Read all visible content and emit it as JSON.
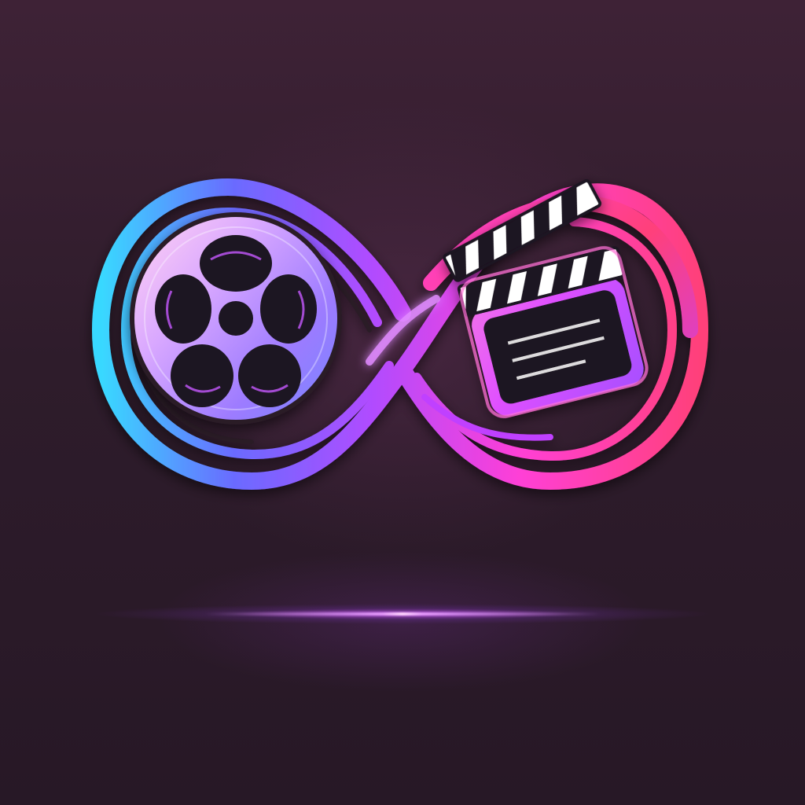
{
  "image": {
    "subject": "infinity-film-logo",
    "colors": {
      "background_top": "#3e2236",
      "background_bottom": "#271826",
      "gradient_cyan": "#39d8ff",
      "gradient_blue": "#6a6bff",
      "gradient_violet": "#b04cff",
      "gradient_magenta": "#ff3fd6",
      "gradient_pink": "#ff3f7a",
      "glow": "#e79cff"
    },
    "icons": [
      "film-reel-icon",
      "clapperboard-icon",
      "infinity-icon"
    ]
  }
}
